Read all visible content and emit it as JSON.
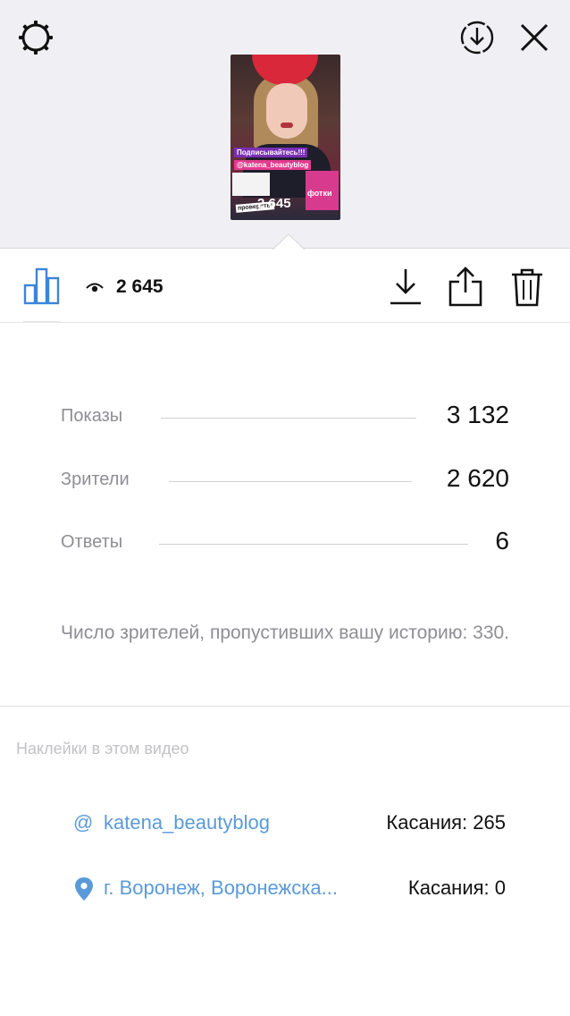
{
  "header": {
    "icons": [
      "settings-icon",
      "download-circle-icon",
      "close-icon"
    ]
  },
  "thumbnail": {
    "sticker_subscribe": "Подписывайтесь!!!",
    "sticker_handle": "@katena_beautyblog",
    "sticker_photos": "фотки",
    "sticker_check": "проверять!",
    "views": "2 645"
  },
  "toolbar": {
    "views_count": "2 645",
    "icons": [
      "bar-chart-icon",
      "eye-icon",
      "save-icon",
      "share-icon",
      "trash-icon"
    ]
  },
  "metrics": [
    {
      "label": "Показы",
      "value": "3 132"
    },
    {
      "label": "Зрители",
      "value": "2 620"
    },
    {
      "label": "Ответы",
      "value": "6"
    }
  ],
  "skipped_text": "Число зрителей, пропустивших вашу историю: 330.",
  "stickers": {
    "heading": "Наклейки в этом видео",
    "items": [
      {
        "icon": "at-icon",
        "symbol": "@",
        "name": "katena_beautyblog",
        "taps": "Касания: 265"
      },
      {
        "icon": "location-pin-icon",
        "symbol": "",
        "name": "г. Воронеж, Воронежска...",
        "taps": "Касания: 0"
      }
    ]
  },
  "colors": {
    "top_background": "#efeff4",
    "link_blue": "#5b9ad8",
    "secondary_text": "#8e8e93",
    "primary_text": "#111111"
  }
}
